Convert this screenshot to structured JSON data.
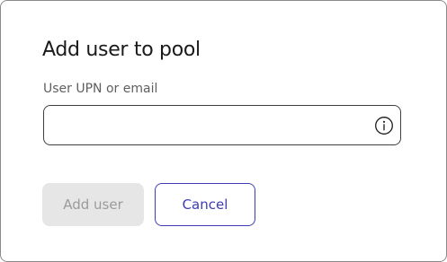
{
  "dialog": {
    "title": "Add user to pool",
    "field": {
      "label": "User UPN or email",
      "value": "",
      "placeholder": "",
      "info_icon": "info-circle-icon"
    },
    "buttons": {
      "primary_label": "Add user",
      "primary_disabled": true,
      "secondary_label": "Cancel"
    }
  },
  "colors": {
    "accent": "#3d3db5",
    "disabled_bg": "#e6e6e6",
    "disabled_text": "#9b9b9b",
    "border": "#3f3f3f"
  }
}
